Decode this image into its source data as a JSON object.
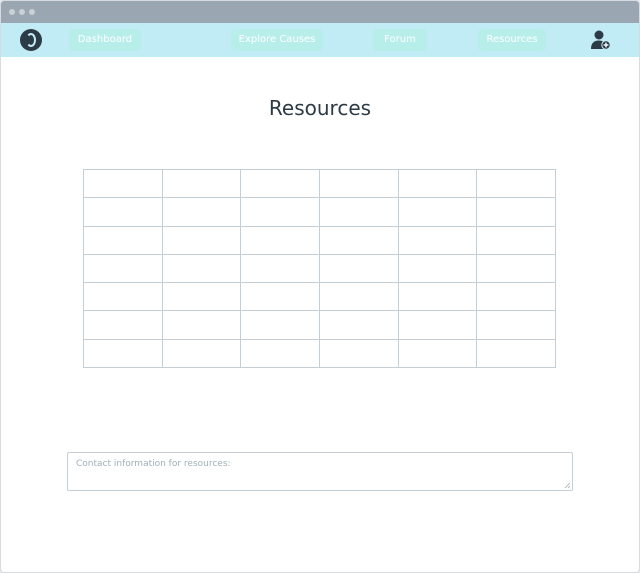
{
  "navbar": {
    "items": [
      {
        "label": "Dashboard"
      },
      {
        "label": "Explore Causes"
      },
      {
        "label": "Forum"
      },
      {
        "label": "Resources"
      }
    ]
  },
  "page": {
    "title": "Resources"
  },
  "table": {
    "rows": [
      [
        "",
        "",
        "",
        "",
        "",
        ""
      ],
      [
        "",
        "",
        "",
        "",
        "",
        ""
      ],
      [
        "",
        "",
        "",
        "",
        "",
        ""
      ],
      [
        "",
        "",
        "",
        "",
        "",
        ""
      ],
      [
        "",
        "",
        "",
        "",
        "",
        ""
      ],
      [
        "",
        "",
        "",
        "",
        "",
        ""
      ],
      [
        "",
        "",
        "",
        "",
        "",
        ""
      ]
    ]
  },
  "contact": {
    "placeholder": "Contact information for resources:"
  },
  "colors": {
    "navbar_bg": "#c1ecf6",
    "nav_item_bg": "#b8eeea",
    "title_text": "#2d3b46",
    "grid_line": "#c3ced6"
  },
  "icons": {
    "logo": "swirl-logo-icon",
    "user": "add-user-icon"
  }
}
